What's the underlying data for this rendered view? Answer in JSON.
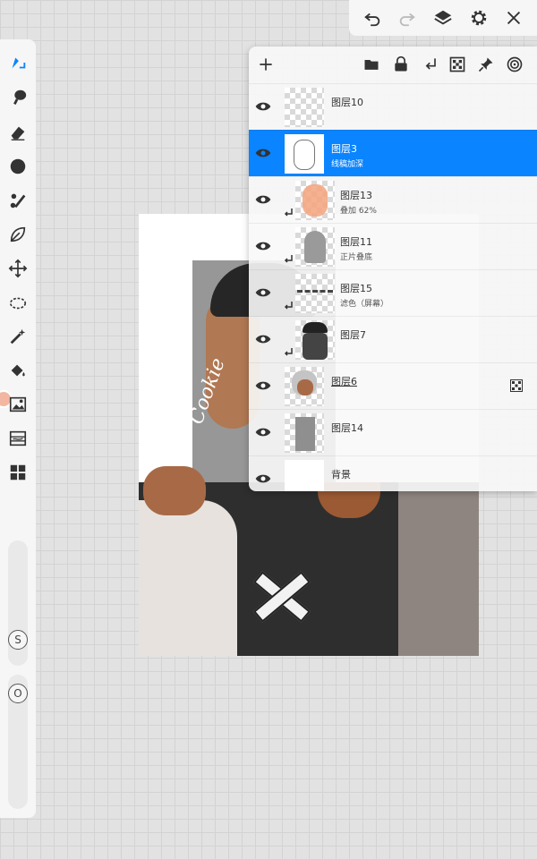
{
  "app": {
    "accent": "#0a84ff"
  },
  "topbar": {
    "icons": [
      "undo-icon",
      "redo-icon",
      "layers-icon",
      "gear-icon",
      "close-icon"
    ]
  },
  "toolbar": {
    "tools": [
      "brush-tool-icon",
      "smudge-tool-icon",
      "eraser-tool-icon",
      "color-tool-icon",
      "brush-library-icon",
      "liquify-icon",
      "transform-icon",
      "lasso-icon",
      "magic-wand-icon",
      "fill-icon",
      "image-import-icon",
      "filter-icon",
      "gallery-icon"
    ],
    "size_button": "S",
    "opacity_button": "O",
    "current_color": "#f3b7a1"
  },
  "artwork": {
    "signature": "Cookie"
  },
  "layers_panel": {
    "header_icons": [
      "add-layer-icon",
      "folder-icon",
      "lock-icon",
      "clip-down-icon",
      "transparency-icon",
      "pin-icon",
      "target-icon"
    ],
    "layers": [
      {
        "name": "图层10",
        "sub": "",
        "selected": false,
        "clipped": false,
        "alpha_locked": false
      },
      {
        "name": "图层3",
        "sub": "线稿加深",
        "selected": true,
        "clipped": false,
        "alpha_locked": false
      },
      {
        "name": "图层13",
        "sub": "叠加 62%",
        "selected": false,
        "clipped": true,
        "alpha_locked": false
      },
      {
        "name": "图层11",
        "sub": "正片叠底",
        "selected": false,
        "clipped": true,
        "alpha_locked": false
      },
      {
        "name": "图层15",
        "sub": "滤色（屏幕）",
        "selected": false,
        "clipped": true,
        "alpha_locked": false
      },
      {
        "name": "图层7",
        "sub": "",
        "selected": false,
        "clipped": true,
        "alpha_locked": false
      },
      {
        "name": "图层6",
        "sub": "",
        "selected": false,
        "clipped": false,
        "alpha_locked": true
      },
      {
        "name": "图层14",
        "sub": "",
        "selected": false,
        "clipped": false,
        "alpha_locked": false
      },
      {
        "name": "背景",
        "sub": "",
        "selected": false,
        "clipped": false,
        "alpha_locked": false
      }
    ]
  }
}
